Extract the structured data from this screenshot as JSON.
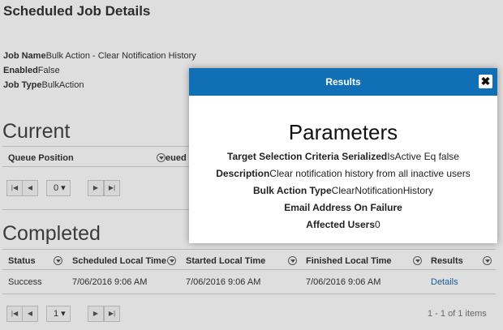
{
  "page": {
    "title": "Scheduled Job Details",
    "job_name_label": "Job Name",
    "job_name_value": "Bulk Action - Clear Notification History",
    "enabled_label": "Enabled",
    "enabled_value": "False",
    "job_type_label": "Job Type",
    "job_type_value": "BulkAction"
  },
  "current": {
    "heading": "Current",
    "col_queue_position": "Queue Position",
    "col_queued_partial": "eued",
    "page_value": "0"
  },
  "completed": {
    "heading": "Completed",
    "columns": [
      "Status",
      "Scheduled Local Time",
      "Started Local Time",
      "Finished Local Time",
      "Results"
    ],
    "row": {
      "status": "Success",
      "scheduled": "7/06/2016 9:06 AM",
      "started": "7/06/2016 9:06 AM",
      "finished": "7/06/2016 9:06 AM",
      "results_link": "Details"
    },
    "page_value": "1",
    "items_info": "1 - 1 of 1 items"
  },
  "modal": {
    "title": "Results",
    "close_glyph": "✖",
    "heading": "Parameters",
    "params": [
      {
        "label": "Target Selection Criteria Serialized",
        "value": "IsActive Eq false"
      },
      {
        "label": "Description",
        "value": "Clear notification history from all inactive users"
      },
      {
        "label": "Bulk Action Type",
        "value": "ClearNotificationHistory"
      },
      {
        "label": "Email Address On Failure",
        "value": ""
      },
      {
        "label": "Affected Users",
        "value": "0"
      }
    ]
  },
  "colors": {
    "header_blue": "#1170b5",
    "link_blue": "#1e6fb0"
  }
}
